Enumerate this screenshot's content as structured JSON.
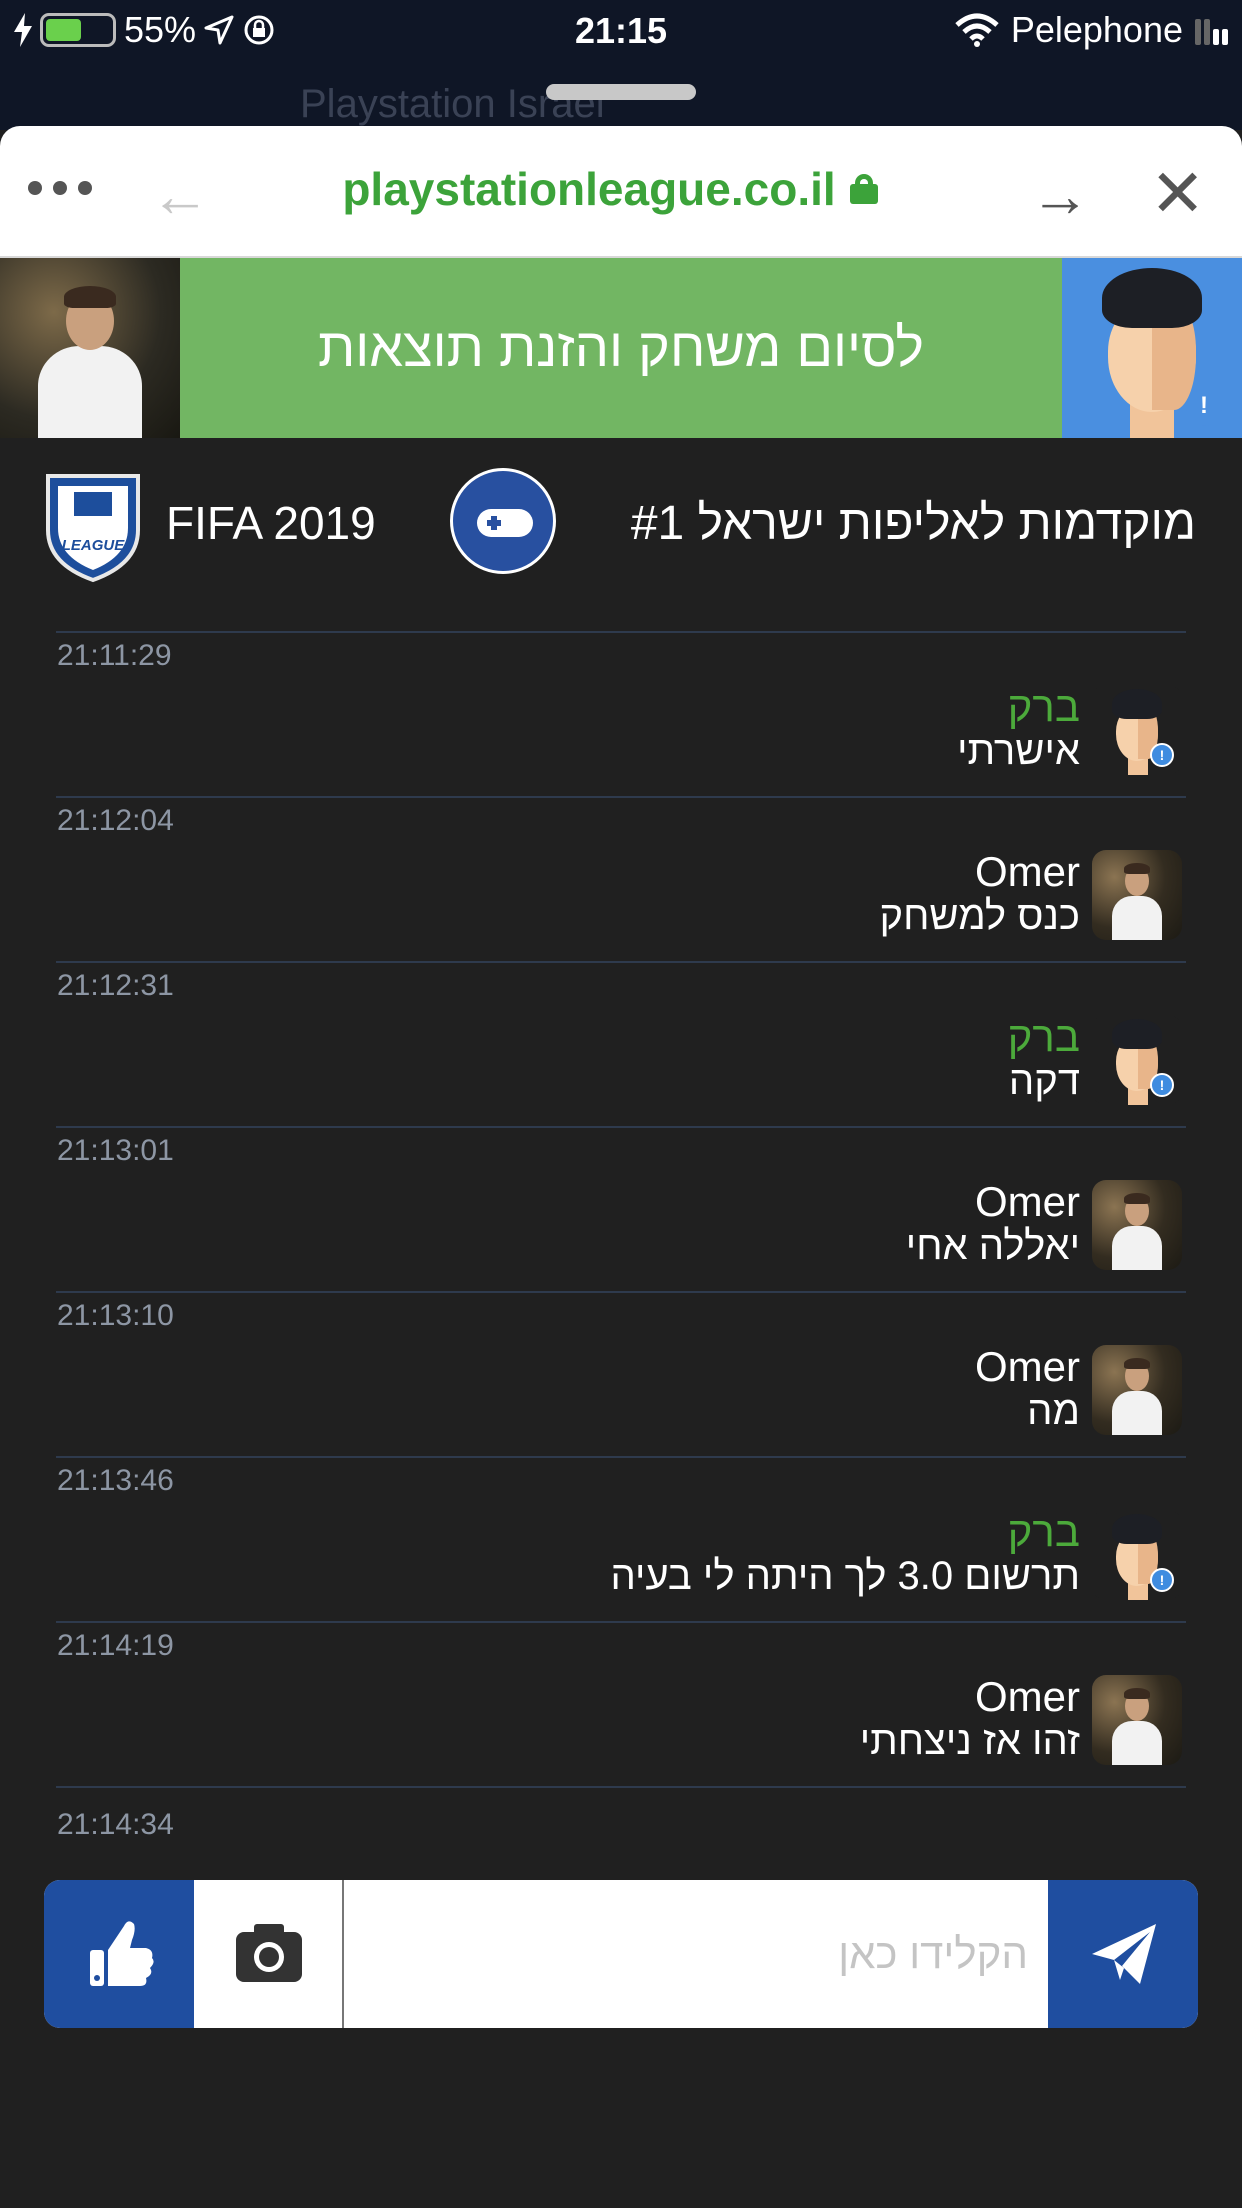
{
  "status_bar": {
    "battery": "55%",
    "battery_level": 0.55,
    "time": "21:15",
    "carrier": "Pelephone"
  },
  "browser": {
    "url": "playstationleague.co.il",
    "background_url_text": "Playstation Israel"
  },
  "banner": {
    "text": "לסיום משחק והזנת תוצאות"
  },
  "titlebar": {
    "game": "FIFA 2019",
    "tournament": "מוקדמות לאליפות ישראל #1"
  },
  "messages": [
    {
      "time": "21:11:29",
      "user": "ברק",
      "text": "אישרתי",
      "avatar": "cartoon"
    },
    {
      "time": "21:12:04",
      "user": "Omer",
      "text": "כנס למשחק",
      "avatar": "photo"
    },
    {
      "time": "21:12:31",
      "user": "ברק",
      "text": "דקה",
      "avatar": "cartoon"
    },
    {
      "time": "21:13:01",
      "user": "Omer",
      "text": "יאללה אחי",
      "avatar": "photo"
    },
    {
      "time": "21:13:10",
      "user": "Omer",
      "text": "מה",
      "avatar": "photo"
    },
    {
      "time": "21:13:46",
      "user": "ברק",
      "text": "תרשום 3.0 לך היתה לי בעיה",
      "avatar": "cartoon"
    },
    {
      "time": "21:14:19",
      "user": "Omer",
      "text": "זהו אז ניצחתי",
      "avatar": "photo"
    }
  ],
  "last_time": "21:14:34",
  "input": {
    "placeholder": "הקלידו כאן",
    "value": ""
  },
  "icons": {
    "like": "thumbs-up-icon",
    "camera": "camera-icon",
    "send": "paper-plane-icon"
  },
  "colors": {
    "accent_blue": "#1f4ea0",
    "banner_green": "#72b663",
    "url_green": "#3ca33a",
    "name_green": "#4caa3b",
    "background": "#202020"
  }
}
